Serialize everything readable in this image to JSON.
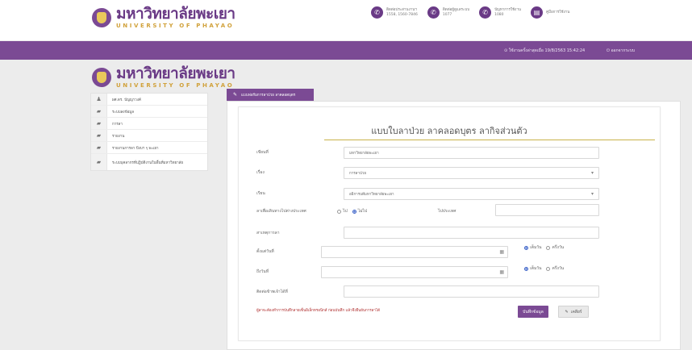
{
  "header": {
    "logo_th": "มหาวิทยาลัยพะเยา",
    "logo_en": "UNIVERSITY OF PHAYAO",
    "contacts": [
      {
        "icon": "phone-icon",
        "line1": "ติดต่อประสานงานฯ",
        "line2": "1558, 1560-7846"
      },
      {
        "icon": "phone-icon",
        "line1": "ติดต่อผู้ดูแลระบบ",
        "line2": "1077"
      },
      {
        "icon": "phone-icon",
        "line1": "ปัญหาการใช้งาน",
        "line2": "1080"
      },
      {
        "icon": "book-icon",
        "line1": "คู่มือการใช้งาน",
        "line2": ""
      }
    ]
  },
  "topbar": {
    "datetime": "⊙ ใช้งานครั้งล่าสุดเมื่อ 19/8/2563 15:42:24",
    "logout_label": "ออกจากระบบ"
  },
  "sidebar": {
    "items": [
      {
        "icon": "user-icon",
        "label": "ผศ.ดร. ปัญญาวงค์"
      },
      {
        "icon": "folder-icon",
        "label": "ระบบลงข้อมูล"
      },
      {
        "icon": "folder-icon",
        "label": "การลา"
      },
      {
        "icon": "folder-icon",
        "label": "รายงาน"
      },
      {
        "icon": "folder-icon",
        "label": "รายงานการลา ปีงบฯ ๆ พะเยา"
      },
      {
        "icon": "folder-icon",
        "label": "ระบบบุคลากรที่ปฏิบัติงานในพื้นที่มหาวิทยาลัย"
      }
    ]
  },
  "tab": {
    "label": "แบบฟอร์มการลาป่วย ลาคลอดบุตร"
  },
  "form": {
    "title": "แบบใบลาป่วย ลาคลอดบุตร ลากิจส่วนตัว",
    "fields": {
      "written_at": {
        "label": "เขียนที่",
        "value": "มหาวิทยาลัยพะเยา"
      },
      "subject": {
        "label": "เรื่อง",
        "value": "การลาป่วย"
      },
      "to": {
        "label": "เรียน",
        "value": "อธิการบดีมหาวิทยาลัยพะเยา"
      },
      "abroad": {
        "label": "ลาเพื่อเดินทางไปต่างประเทศ",
        "opt_yes": "ไป",
        "opt_no": "ไม่ไป",
        "selected": "no",
        "country_label": "ไปประเทศ",
        "country_value": ""
      },
      "reason": {
        "label": "สาเหตุการลา",
        "value": ""
      },
      "from_date": {
        "label": "ตั้งแต่วันที่",
        "value": "",
        "opt_full": "เต็มวัน",
        "opt_half": "ครึ่งวัน",
        "selected": "full"
      },
      "to_date": {
        "label": "ถึงวันที่",
        "value": "",
        "opt_full": "เต็มวัน",
        "opt_half": "ครึ่งวัน",
        "selected": "full"
      },
      "contact": {
        "label": "ติดต่อข้าพเจ้าได้ที่",
        "value": ""
      }
    },
    "note": "ผู้ลาจะต้องทำการบันทึกลายเซ็นอิเล็กทรอนิกส์ ก่อนบันทึก แล้วจึงยืนยันการลาได้",
    "save_label": "บันทึกข้อมูล",
    "clear_label": "เคลียร์"
  },
  "colors": {
    "brand_purple": "#7b4a94",
    "gold": "#d1a23c",
    "note_red": "#b03030",
    "radio_blue": "#3b62c8"
  }
}
